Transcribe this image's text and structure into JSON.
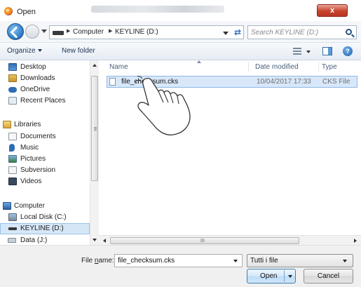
{
  "window": {
    "title": "Open",
    "close_glyph": "x"
  },
  "address": {
    "crumbs": [
      "Computer",
      "KEYLINE (D:)"
    ],
    "search_placeholder": "Search KEYLINE (D:)"
  },
  "toolbar": {
    "organize_label": "Organize",
    "new_folder_label": "New folder"
  },
  "nav": {
    "items": [
      {
        "label": "Desktop",
        "icon": "desktop-icon"
      },
      {
        "label": "Downloads",
        "icon": "downloads-icon"
      },
      {
        "label": "OneDrive",
        "icon": "onedrive-icon"
      },
      {
        "label": "Recent Places",
        "icon": "recent-places-icon"
      },
      {
        "label": "Libraries",
        "icon": "libraries-icon"
      },
      {
        "label": "Documents",
        "icon": "documents-icon"
      },
      {
        "label": "Music",
        "icon": "music-icon"
      },
      {
        "label": "Pictures",
        "icon": "pictures-icon"
      },
      {
        "label": "Subversion",
        "icon": "subversion-icon"
      },
      {
        "label": "Videos",
        "icon": "videos-icon"
      },
      {
        "label": "Computer",
        "icon": "computer-icon"
      },
      {
        "label": "Local Disk (C:)",
        "icon": "local-disk-icon"
      },
      {
        "label": "KEYLINE (D:)",
        "icon": "usb-drive-icon"
      },
      {
        "label": "Data (J:)",
        "icon": "network-drive-icon"
      }
    ]
  },
  "columns": {
    "name": "Name",
    "date_modified": "Date modified",
    "type": "Type"
  },
  "files": [
    {
      "name": "file_checksum.cks",
      "date": "10/04/2017 17:33",
      "type": "CKS File"
    }
  ],
  "bottom": {
    "filename_label_pre": "File ",
    "filename_label_accel": "n",
    "filename_label_post": "ame:",
    "filename_value": "file_checksum.cks",
    "filetype_value": "Tutti i file",
    "open_label": "Open",
    "cancel_label": "Cancel"
  },
  "scroll_glyph": "III"
}
